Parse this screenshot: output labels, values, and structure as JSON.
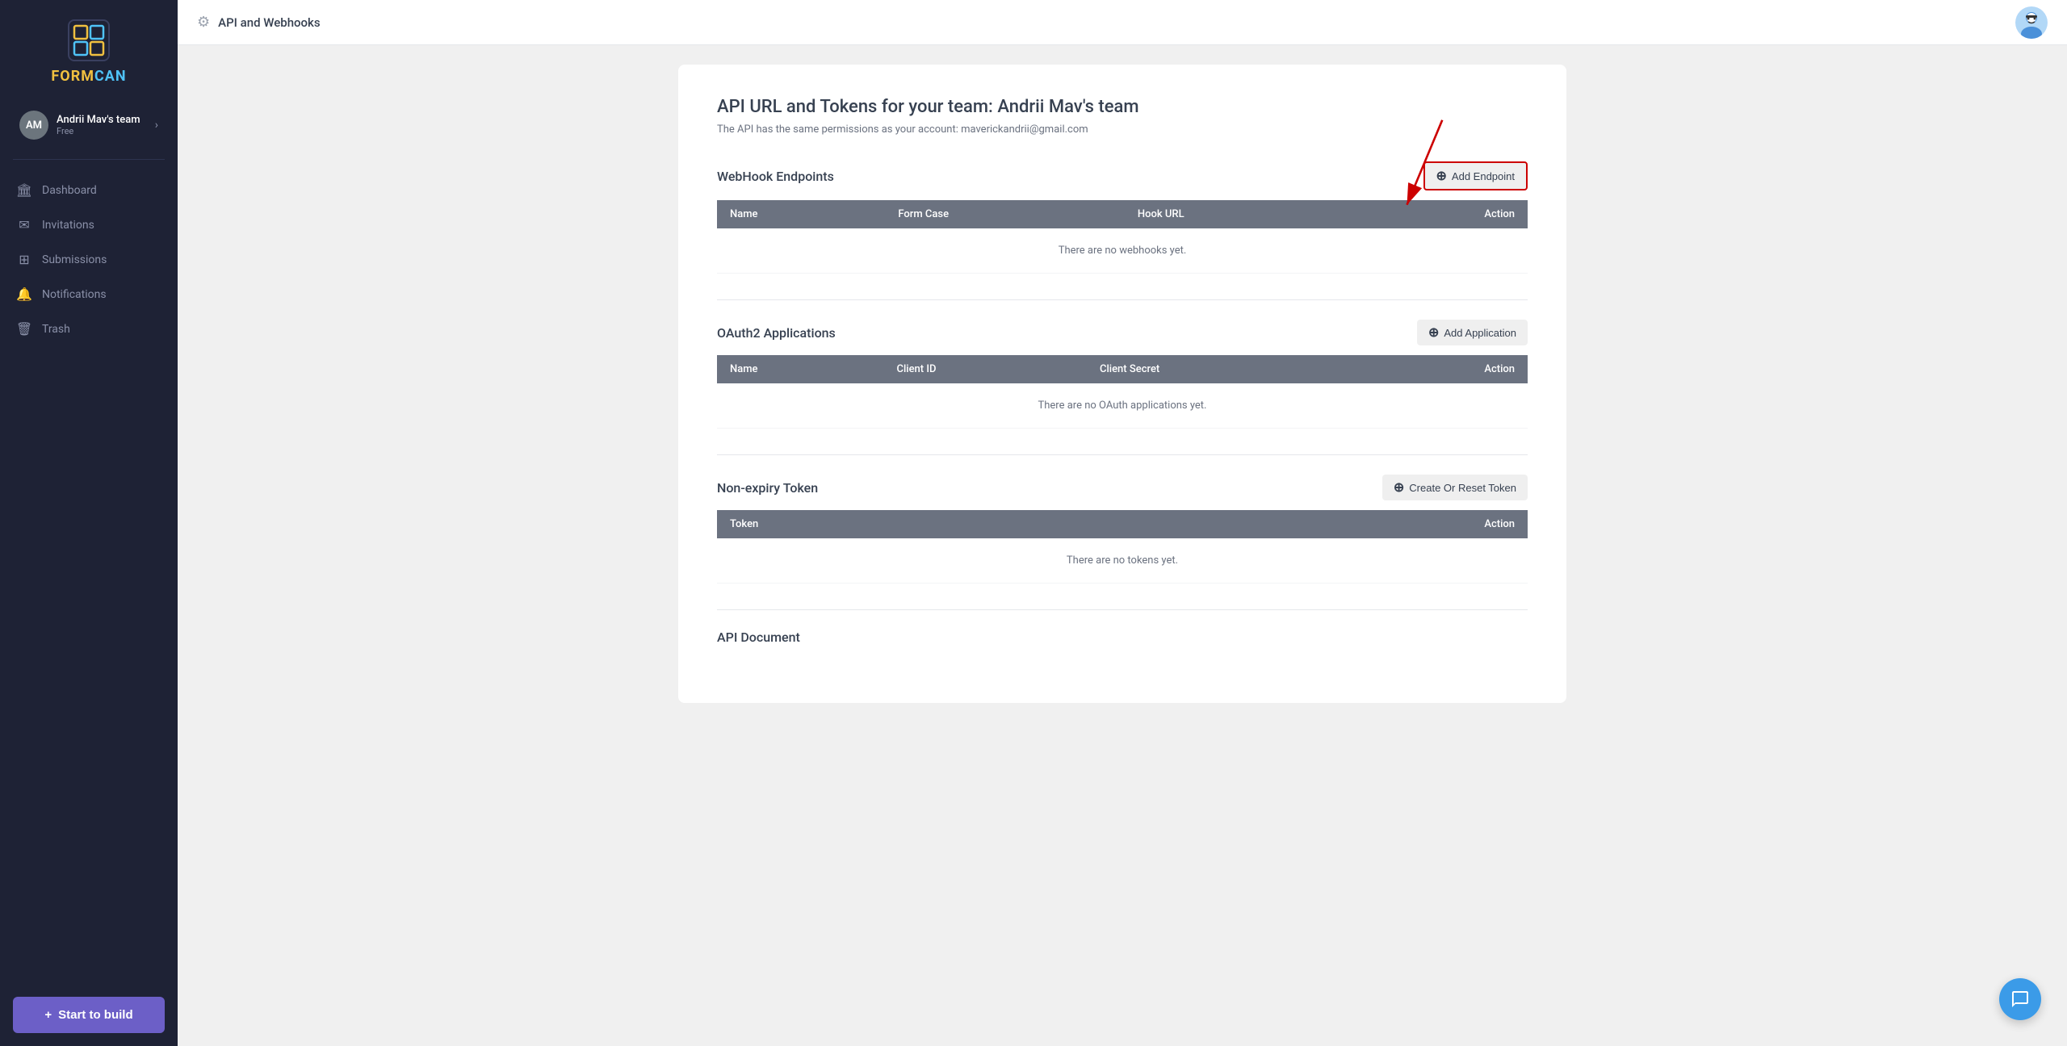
{
  "sidebar": {
    "logo_text_form": "FORM",
    "logo_text_can": "CAN",
    "team": {
      "initials": "AM",
      "name": "Andrii Mav's team",
      "plan": "Free"
    },
    "nav_items": [
      {
        "id": "dashboard",
        "label": "Dashboard",
        "icon": "🏛"
      },
      {
        "id": "invitations",
        "label": "Invitations",
        "icon": "✉"
      },
      {
        "id": "submissions",
        "label": "Submissions",
        "icon": "⊞"
      },
      {
        "id": "notifications",
        "label": "Notifications",
        "icon": "🔔"
      },
      {
        "id": "trash",
        "label": "Trash",
        "icon": "🗑"
      }
    ],
    "start_build_label": "Start to build",
    "start_build_plus": "+"
  },
  "header": {
    "title": "API and Webhooks",
    "gear_icon": "⚙"
  },
  "main": {
    "page_title": "API URL and Tokens for your team: Andrii Mav's team",
    "page_subtitle": "The API has the same permissions as your account: maverickandrii@gmail.com",
    "sections": {
      "webhook": {
        "title": "WebHook Endpoints",
        "action_label": "Add Endpoint",
        "columns": [
          "Name",
          "Form Case",
          "Hook URL",
          "Action"
        ],
        "empty_message": "There are no webhooks yet."
      },
      "oauth2": {
        "title": "OAuth2 Applications",
        "action_label": "Add Application",
        "columns": [
          "Name",
          "Client ID",
          "Client Secret",
          "Action"
        ],
        "empty_message": "There are no OAuth applications yet."
      },
      "token": {
        "title": "Non-expiry Token",
        "action_label": "Create Or Reset Token",
        "columns": [
          "Token",
          "Action"
        ],
        "empty_message": "There are no tokens yet."
      },
      "api_doc": {
        "title": "API Document"
      }
    }
  }
}
